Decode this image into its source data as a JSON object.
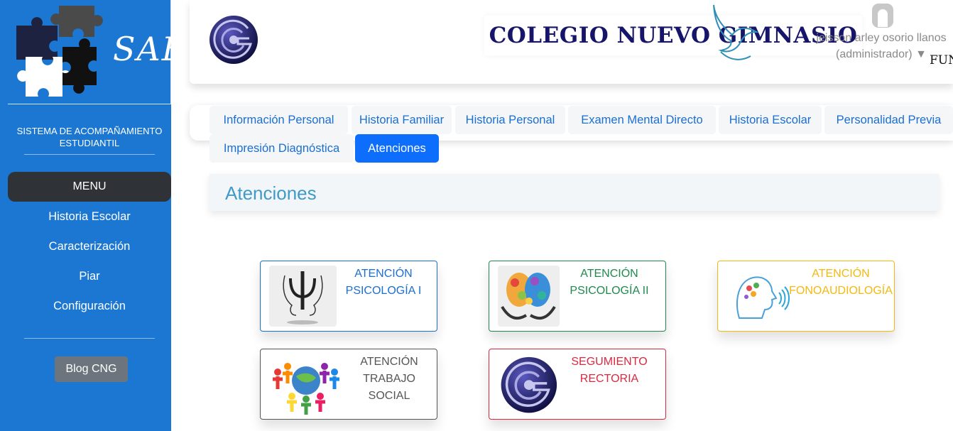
{
  "sidebar": {
    "logo_text": "SAE",
    "system_name": "SISTEMA DE ACOMPAÑAMIENTO ESTUDIANTIL",
    "menu_label": "MENU",
    "items": [
      {
        "label": "Historia Escolar"
      },
      {
        "label": "Caracterización"
      },
      {
        "label": "Piar"
      },
      {
        "label": "Configuración"
      }
    ],
    "blog_label": "Blog CNG"
  },
  "header": {
    "school_title": "COLEGIO NUEVO GIMNASIO",
    "partner_logo_text": "FUNDAR",
    "user_name": "jeisson arley osorio llanos",
    "user_role": "(administrador)",
    "dropdown_glyph": "▼"
  },
  "tabs": [
    {
      "label": "Información Personal",
      "active": false
    },
    {
      "label": "Historia Familiar",
      "active": false
    },
    {
      "label": "Historia Personal",
      "active": false
    },
    {
      "label": "Examen Mental Directo",
      "active": false
    },
    {
      "label": "Historia Escolar",
      "active": false
    },
    {
      "label": "Personalidad Previa",
      "active": false
    },
    {
      "label": "Impresión Diagnóstica",
      "active": false
    },
    {
      "label": "Atenciones",
      "active": true
    }
  ],
  "section": {
    "title": "Atenciones"
  },
  "cards": [
    {
      "line1": "ATENCIÓN",
      "line2": "PSICOLOGÍA I",
      "line3": "",
      "color": "#1b6fd0",
      "icon": "psychology-icon"
    },
    {
      "line1": "ATENCIÓN",
      "line2": "PSICOLOGÍA II",
      "line3": "",
      "color": "#1f8a4c",
      "icon": "brain-icon"
    },
    {
      "line1": "ATENCIÓN",
      "line2": "FONOAUDIOLOGÍA",
      "line3": "",
      "color": "#f2b90f",
      "icon": "speech-head-icon"
    },
    {
      "line1": "ATENCIÓN",
      "line2": "TRABAJO",
      "line3": "SOCIAL",
      "color": "#555555",
      "icon": "social-people-icon"
    },
    {
      "line1": "SEGUMIENTO",
      "line2": "RECTORIA",
      "line3": "",
      "color": "#d9293f",
      "icon": "school-logo-icon"
    }
  ]
}
